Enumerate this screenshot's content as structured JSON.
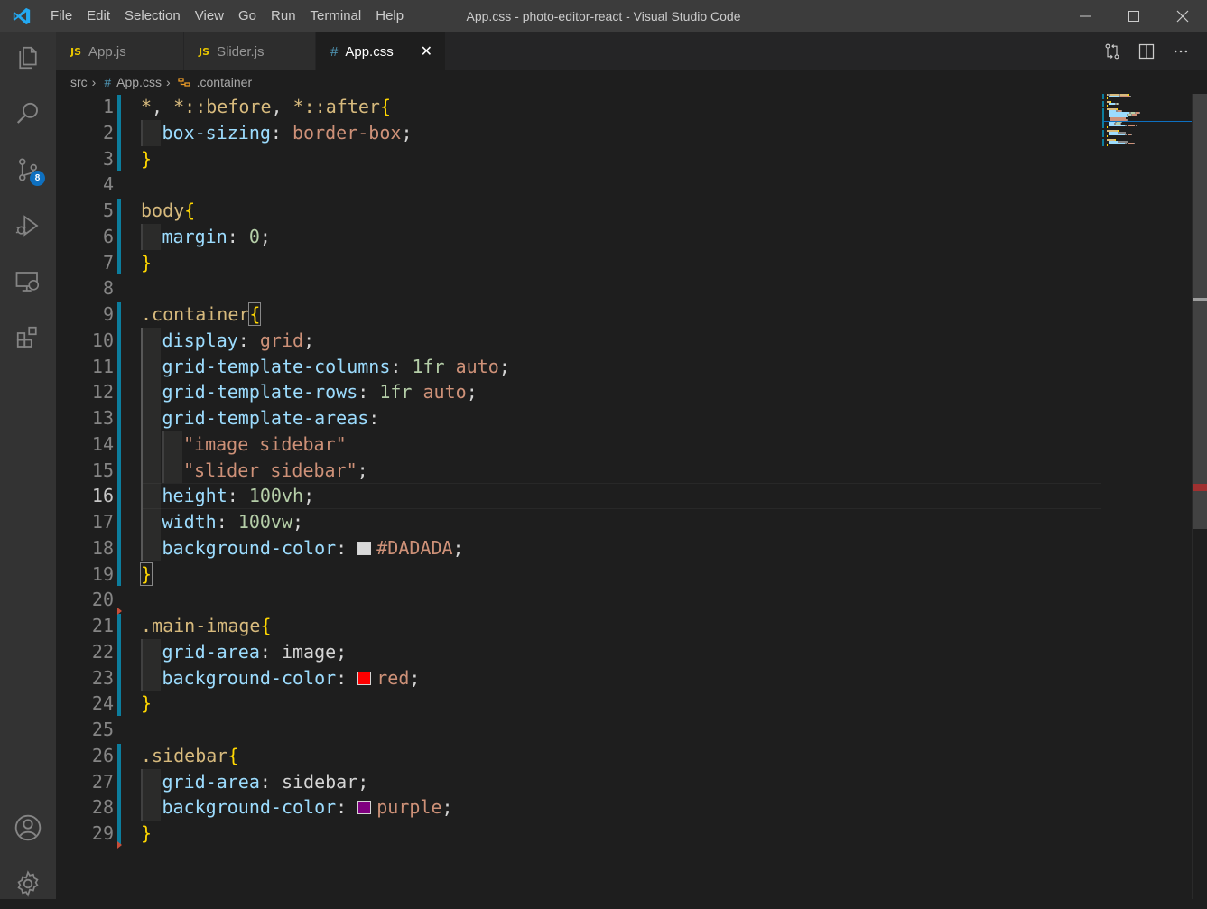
{
  "window": {
    "title": "App.css - photo-editor-react - Visual Studio Code",
    "menu": [
      "File",
      "Edit",
      "Selection",
      "View",
      "Go",
      "Run",
      "Terminal",
      "Help"
    ]
  },
  "activity_bar": {
    "items": [
      "explorer-icon",
      "search-icon",
      "source-control-icon",
      "run-debug-icon",
      "remote-explorer-icon",
      "extensions-icon",
      "account-icon",
      "manage-gear-icon"
    ],
    "source_control_badge": "8"
  },
  "tabs": [
    {
      "label": "App.js",
      "icon": "JS",
      "active": false
    },
    {
      "label": "Slider.js",
      "icon": "JS",
      "active": false
    },
    {
      "label": "App.css",
      "icon": "#",
      "active": true
    }
  ],
  "tab_close_glyph": "✕",
  "breadcrumb": {
    "folder": "src",
    "file": "App.css",
    "symbol": ".container"
  },
  "editor": {
    "line_numbers": [
      "1",
      "2",
      "3",
      "4",
      "5",
      "6",
      "7",
      "8",
      "9",
      "10",
      "11",
      "12",
      "13",
      "14",
      "15",
      "16",
      "17",
      "18",
      "19",
      "20",
      "21",
      "22",
      "23",
      "24",
      "25",
      "26",
      "27",
      "28",
      "29"
    ],
    "lines": [
      [
        [
          "sel",
          "*"
        ],
        [
          "pun",
          ", "
        ],
        [
          "sel",
          "*::before"
        ],
        [
          "pun",
          ", "
        ],
        [
          "sel",
          "*::after"
        ],
        [
          "br",
          "{"
        ]
      ],
      [
        [
          "prop",
          "box-sizing"
        ],
        [
          "pun",
          ": "
        ],
        [
          "val",
          "border-box"
        ],
        [
          "pun",
          ";"
        ]
      ],
      [
        [
          "br",
          "}"
        ]
      ],
      [],
      [
        [
          "sel",
          "body"
        ],
        [
          "br",
          "{"
        ]
      ],
      [
        [
          "prop",
          "margin"
        ],
        [
          "pun",
          ": "
        ],
        [
          "num",
          "0"
        ],
        [
          "pun",
          ";"
        ]
      ],
      [
        [
          "br",
          "}"
        ]
      ],
      [],
      [
        [
          "sel",
          ".container"
        ],
        [
          "br",
          "{"
        ]
      ],
      [
        [
          "prop",
          "display"
        ],
        [
          "pun",
          ": "
        ],
        [
          "val",
          "grid"
        ],
        [
          "pun",
          ";"
        ]
      ],
      [
        [
          "prop",
          "grid-template-columns"
        ],
        [
          "pun",
          ": "
        ],
        [
          "num",
          "1fr"
        ],
        [
          "pun",
          " "
        ],
        [
          "val",
          "auto"
        ],
        [
          "pun",
          ";"
        ]
      ],
      [
        [
          "prop",
          "grid-template-rows"
        ],
        [
          "pun",
          ": "
        ],
        [
          "num",
          "1fr"
        ],
        [
          "pun",
          " "
        ],
        [
          "val",
          "auto"
        ],
        [
          "pun",
          ";"
        ]
      ],
      [
        [
          "prop",
          "grid-template-areas"
        ],
        [
          "pun",
          ":"
        ]
      ],
      [
        [
          "str",
          "\"image sidebar\""
        ]
      ],
      [
        [
          "str",
          "\"slider sidebar\""
        ],
        [
          "pun",
          ";"
        ]
      ],
      [
        [
          "prop",
          "height"
        ],
        [
          "pun",
          ": "
        ],
        [
          "num",
          "100vh"
        ],
        [
          "pun",
          ";"
        ]
      ],
      [
        [
          "prop",
          "width"
        ],
        [
          "pun",
          ": "
        ],
        [
          "num",
          "100vw"
        ],
        [
          "pun",
          ";"
        ]
      ],
      [
        [
          "prop",
          "background-color"
        ],
        [
          "pun",
          ": "
        ],
        [
          "swatch",
          "#DADADA"
        ],
        [
          "val",
          "#DADADA"
        ],
        [
          "pun",
          ";"
        ]
      ],
      [
        [
          "br",
          "}"
        ]
      ],
      [],
      [
        [
          "sel",
          ".main-image"
        ],
        [
          "br",
          "{"
        ]
      ],
      [
        [
          "prop",
          "grid-area"
        ],
        [
          "pun",
          ": image;"
        ]
      ],
      [
        [
          "prop",
          "background-color"
        ],
        [
          "pun",
          ": "
        ],
        [
          "swatch",
          "#ff0000"
        ],
        [
          "val",
          "red"
        ],
        [
          "pun",
          ";"
        ]
      ],
      [
        [
          "br",
          "}"
        ]
      ],
      [],
      [
        [
          "sel",
          ".sidebar"
        ],
        [
          "br",
          "{"
        ]
      ],
      [
        [
          "prop",
          "grid-area"
        ],
        [
          "pun",
          ": sidebar;"
        ]
      ],
      [
        [
          "prop",
          "background-color"
        ],
        [
          "pun",
          ": "
        ],
        [
          "swatch",
          "#800080"
        ],
        [
          "val",
          "purple"
        ],
        [
          "pun",
          ";"
        ]
      ],
      [
        [
          "br",
          "}"
        ]
      ]
    ],
    "indent": [
      0,
      1,
      0,
      0,
      0,
      1,
      0,
      0,
      0,
      1,
      1,
      1,
      1,
      2,
      2,
      1,
      1,
      1,
      0,
      0,
      0,
      1,
      1,
      0,
      0,
      0,
      1,
      1,
      0
    ],
    "current_line": 16
  },
  "colors": {
    "selector": "#d7ba7d",
    "property": "#9cdcfe",
    "value": "#ce9178",
    "number": "#b5cea8",
    "bracket": "#ffd700",
    "accent_blue": "#0e70c0",
    "badge_blue": "#0e70c0"
  }
}
